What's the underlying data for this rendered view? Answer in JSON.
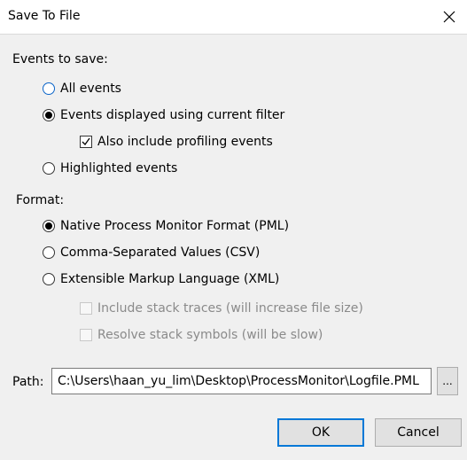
{
  "window": {
    "title": "Save To File"
  },
  "events_group": {
    "label": "Events to save:",
    "options": [
      {
        "label": "All events",
        "selected": false
      },
      {
        "label": "Events displayed using current filter",
        "selected": true
      },
      {
        "label": "Highlighted events",
        "selected": false
      }
    ],
    "profiling_checkbox": {
      "label": "Also include profiling events",
      "checked": true
    }
  },
  "format_group": {
    "label": "Format:",
    "options": [
      {
        "label": "Native Process Monitor Format (PML)",
        "selected": true
      },
      {
        "label": "Comma-Separated Values (CSV)",
        "selected": false
      },
      {
        "label": "Extensible Markup Language (XML)",
        "selected": false
      }
    ],
    "xml_options": [
      {
        "label": "Include stack traces (will increase file size)",
        "checked": false,
        "enabled": false
      },
      {
        "label": "Resolve stack symbols (will be slow)",
        "checked": false,
        "enabled": false
      }
    ]
  },
  "path": {
    "label": "Path:",
    "value": "C:\\Users\\haan_yu_lim\\Desktop\\ProcessMonitor\\Logfile.PML",
    "browse_label": "..."
  },
  "buttons": {
    "ok": "OK",
    "cancel": "Cancel"
  },
  "colors": {
    "accent": "#0078d7",
    "disabled_text": "#8a8a8a"
  }
}
